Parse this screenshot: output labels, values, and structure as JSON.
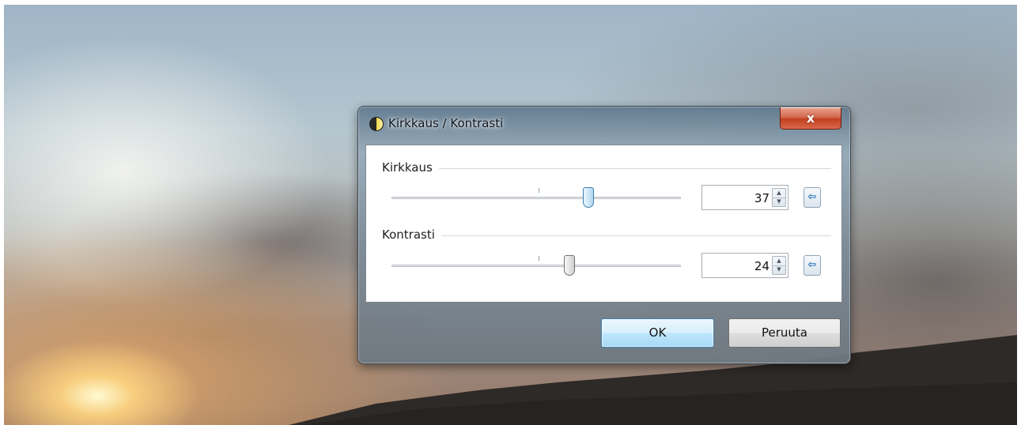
{
  "dialog": {
    "title": "Kirkkaus / Kontrasti",
    "close_glyph": "x",
    "title_icon": "brightness-contrast-icon"
  },
  "brightness": {
    "label": "Kirkkaus",
    "value": "37",
    "slider_value": 37,
    "spin_up": "▲",
    "spin_down": "▼",
    "reset_glyph": "⇦",
    "reset_icon": "arrow-left-icon"
  },
  "contrast": {
    "label": "Kontrasti",
    "value": "24",
    "slider_value": 24,
    "spin_up": "▲",
    "spin_down": "▼",
    "reset_glyph": "⇦",
    "reset_icon": "arrow-left-icon"
  },
  "buttons": {
    "ok": "OK",
    "cancel": "Peruuta"
  },
  "colors": {
    "close_button": "#c2401f",
    "default_button": "#a7d9f5",
    "reset_arrow": "#1e6fb8"
  }
}
